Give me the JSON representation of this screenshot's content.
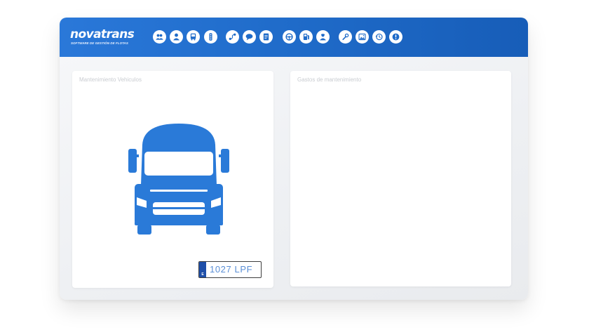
{
  "app": {
    "brand": "novatrans",
    "tagline": "SOFTWARE DE GESTIÓN DE FLOTAS",
    "accent": "#1f6bc9"
  },
  "toolbar": {
    "icons": [
      "users-icon",
      "user-icon",
      "bus-icon",
      "traffic-light-icon",
      "route-icon",
      "chat-icon",
      "document-icon",
      "steering-wheel-icon",
      "fuel-pump-icon",
      "mechanic-icon",
      "wrench-icon",
      "image-icon",
      "history-icon",
      "alert-icon"
    ]
  },
  "panels": {
    "left": {
      "title": "Mantenimiento Vehiculos",
      "vehicle_color": "#2a7ad8",
      "plate": {
        "country": "E",
        "number": "1027  LPF"
      }
    },
    "right": {
      "title": "Gastos de mantenimiento"
    }
  }
}
